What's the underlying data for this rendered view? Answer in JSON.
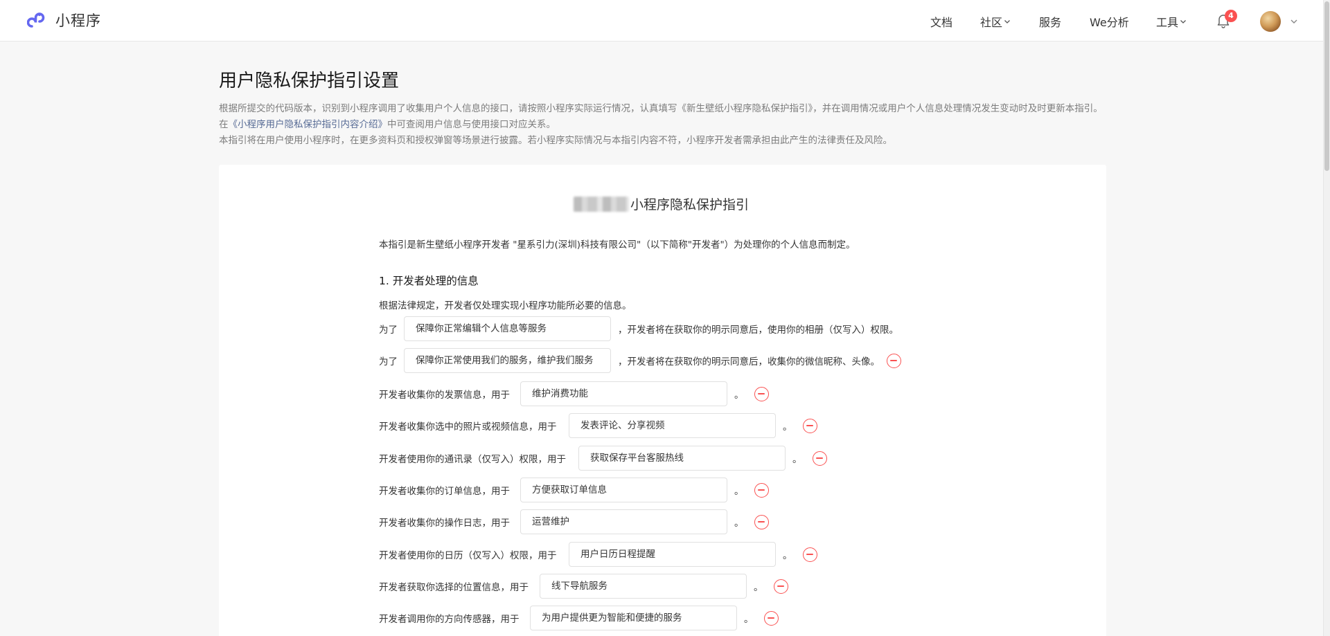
{
  "header": {
    "logo_text": "小程序",
    "nav": [
      {
        "label": "文档",
        "dropdown": false
      },
      {
        "label": "社区",
        "dropdown": true
      },
      {
        "label": "服务",
        "dropdown": false
      },
      {
        "label": "We分析",
        "dropdown": false
      },
      {
        "label": "工具",
        "dropdown": true
      }
    ],
    "notification_count": "4",
    "icons": {
      "bell": "bell-icon",
      "avatar": "user-avatar",
      "chevron": "chevron-down-icon",
      "logo": "mini-program-logo-icon"
    }
  },
  "page": {
    "title": "用户隐私保护指引设置",
    "intro_line1": "根据所提交的代码版本，识别到小程序调用了收集用户个人信息的接口，请按照小程序实际运行情况，认真填写《新生壁纸小程序隐私保护指引》，并在调用情况或用户个人信息处理情况发生变动时及时更新本指引。在",
    "intro_link": "《小程序用户隐私保护指引内容介绍》",
    "intro_line1_tail": "中可查阅用户信息与使用接口对应关系。",
    "intro_line2": "本指引将在用户使用小程序时，在更多资料页和授权弹窗等场景进行披露。若小程序实际情况与本指引内容不符，小程序开发者需承担由此产生的法律责任及风险。"
  },
  "guide": {
    "title": "小程序隐私保护指引",
    "statement": "本指引是新生壁纸小程序开发者 \"星系引力(深圳)科技有限公司\"（以下简称\"开发者\"）为处理你的个人信息而制定。",
    "section1_title": "1. 开发者处理的信息",
    "section1_desc": "根据法律规定，开发者仅处理实现小程序功能所必要的信息。",
    "items": [
      {
        "lead": "为了",
        "value": "保障你正常编辑个人信息等服务",
        "tail": "，开发者将在获取你的明示同意后，使用你的相册（仅写入）权限。",
        "removable": false
      },
      {
        "lead": "为了",
        "value": "保障你正常使用我们的服务，维护我们服务",
        "tail": "，开发者将在获取你的明示同意后，收集你的微信昵称、头像。",
        "removable": true
      },
      {
        "lead": "开发者收集你的发票信息，用于",
        "value": "维护消费功能",
        "tail": "。",
        "removable": true
      },
      {
        "lead": "开发者收集你选中的照片或视频信息，用于",
        "value": "发表评论、分享视频",
        "tail": "。",
        "removable": true
      },
      {
        "lead": "开发者使用你的通讯录（仅写入）权限，用于",
        "value": "获取保存平台客服热线",
        "tail": "。",
        "removable": true
      },
      {
        "lead": "开发者收集你的订单信息，用于",
        "value": "方便获取订单信息",
        "tail": "。",
        "removable": true
      },
      {
        "lead": "开发者收集你的操作日志，用于",
        "value": "运营维护",
        "tail": "。",
        "removable": true
      },
      {
        "lead": "开发者使用你的日历（仅写入）权限，用于",
        "value": "用户日历日程提醒",
        "tail": "。",
        "removable": true
      },
      {
        "lead": "开发者获取你选择的位置信息，用于",
        "value": "线下导航服务",
        "tail": "。",
        "removable": true
      },
      {
        "lead": "开发者调用你的方向传感器，用于",
        "value": "为用户提供更为智能和便捷的服务",
        "tail": "。",
        "removable": true
      }
    ]
  },
  "colors": {
    "accent_link": "#576b95",
    "remove_red": "#fa5151",
    "badge_red": "#fa5151",
    "brand_purple": "#6467f0"
  }
}
